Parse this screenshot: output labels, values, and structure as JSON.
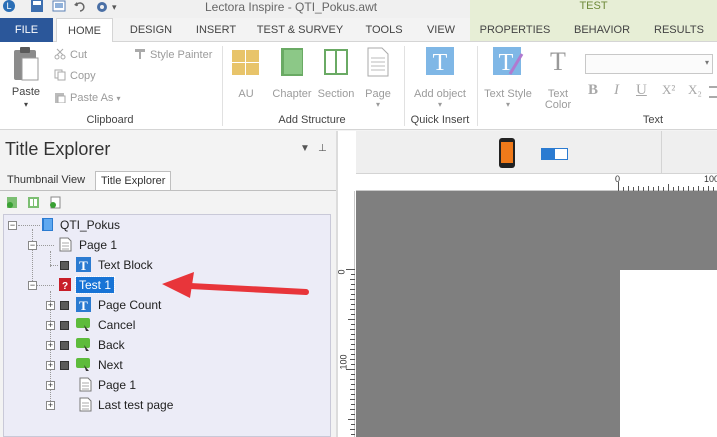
{
  "window": {
    "app_title": "Lectora Inspire - QTI_Pokus.awt",
    "context_group": "TEST"
  },
  "tabs": {
    "file": "FILE",
    "home": "HOME",
    "design": "DESIGN",
    "insert": "INSERT",
    "test_survey": "TEST & SURVEY",
    "tools": "TOOLS",
    "view": "VIEW",
    "properties": "PROPERTIES",
    "behavior": "BEHAVIOR",
    "results": "RESULTS"
  },
  "ribbon": {
    "clipboard": {
      "label": "Clipboard",
      "paste": "Paste",
      "cut": "Cut",
      "copy": "Copy",
      "paste_as": "Paste As",
      "style_painter": "Style Painter"
    },
    "add_structure": {
      "label": "Add Structure",
      "au": "AU",
      "chapter": "Chapter",
      "section": "Section",
      "page": "Page"
    },
    "quick_insert": {
      "label": "Quick Insert",
      "add_object": "Add object"
    },
    "text": {
      "label": "Text",
      "text_style": "Text Style",
      "text_color_line1": "Text",
      "text_color_line2": "Color",
      "bold": "B",
      "italic": "I",
      "underline": "U",
      "superscript": "X²",
      "subscript": "X₂"
    }
  },
  "panel": {
    "title": "Title Explorer",
    "tabs": [
      "Thumbnail View",
      "Title Explorer"
    ],
    "tree": {
      "root": "QTI_Pokus",
      "page1": "Page 1",
      "text_block": "Text Block",
      "test1": "Test 1",
      "page_count": "Page Count",
      "cancel": "Cancel",
      "back": "Back",
      "next": "Next",
      "test_page1": "Page 1",
      "last_test_page": "Last test page"
    }
  },
  "canvas": {
    "ruler_h": [
      "0",
      "100"
    ],
    "ruler_v": [
      "0",
      "100"
    ]
  },
  "colors": {
    "file_tab": "#2b579a",
    "selection": "#1874d6",
    "arrow": "#e8353a",
    "context_tab": "#e7eed6"
  }
}
